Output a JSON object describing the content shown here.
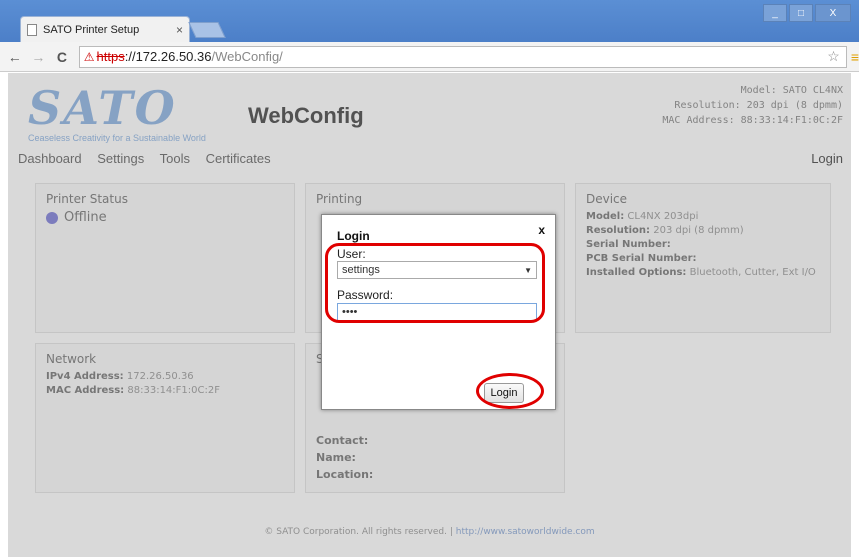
{
  "browser": {
    "tab_title": "SATO Printer Setup",
    "tab_close": "×",
    "url_warning": "⚠",
    "url_scheme": "https",
    "url_host": "://172.26.50.36",
    "url_path": "/WebConfig/",
    "back": "←",
    "forward": "→",
    "reload": "C",
    "star": "☆",
    "menu": "≡",
    "win_min": "_",
    "win_max": "□",
    "win_close": "X"
  },
  "header": {
    "logo": "SATO",
    "tagline": "Ceaseless Creativity for a Sustainable World",
    "app_title": "WebConfig",
    "model": "Model: SATO CL4NX",
    "resolution": "Resolution: 203 dpi (8 dpmm)",
    "mac": "MAC Address: 88:33:14:F1:0C:2F"
  },
  "nav": {
    "items": [
      "Dashboard",
      "Settings",
      "Tools",
      "Certificates"
    ],
    "login": "Login"
  },
  "panels": {
    "printer_status": {
      "title": "Printer Status",
      "status": "Offline"
    },
    "printing": {
      "title": "Printing"
    },
    "device": {
      "title": "Device",
      "model_label": "Model:",
      "model_value": "CL4NX 203dpi",
      "resolution_label": "Resolution:",
      "resolution_value": "203 dpi (8 dpmm)",
      "serial_label": "Serial Number:",
      "pcb_label": "PCB Serial Number:",
      "options_label": "Installed Options:",
      "options_value": "Bluetooth, Cutter, Ext I/O"
    },
    "network": {
      "title": "Network",
      "ipv4_label": "IPv4 Address:",
      "ipv4_value": "172.26.50.36",
      "mac_label": "MAC Address:",
      "mac_value": "88:33:14:F1:0C:2F"
    },
    "system": {
      "title": "S",
      "contact_label": "Contact:",
      "name_label": "Name:",
      "location_label": "Location:"
    }
  },
  "footer": {
    "copyright": "© SATO Corporation. All rights reserved. |",
    "link": "http://www.satoworldwide.com"
  },
  "login_dialog": {
    "title": "Login",
    "close": "x",
    "user_label": "User:",
    "user_value": "settings",
    "select_arrow": "▼",
    "password_label": "Password:",
    "password_value": "••••",
    "submit": "Login"
  },
  "colors": {
    "highlight": "#e00000",
    "titlebar": "#4c7fc8",
    "logo": "#8db3e2",
    "status_dot": "#7e7ed9"
  }
}
